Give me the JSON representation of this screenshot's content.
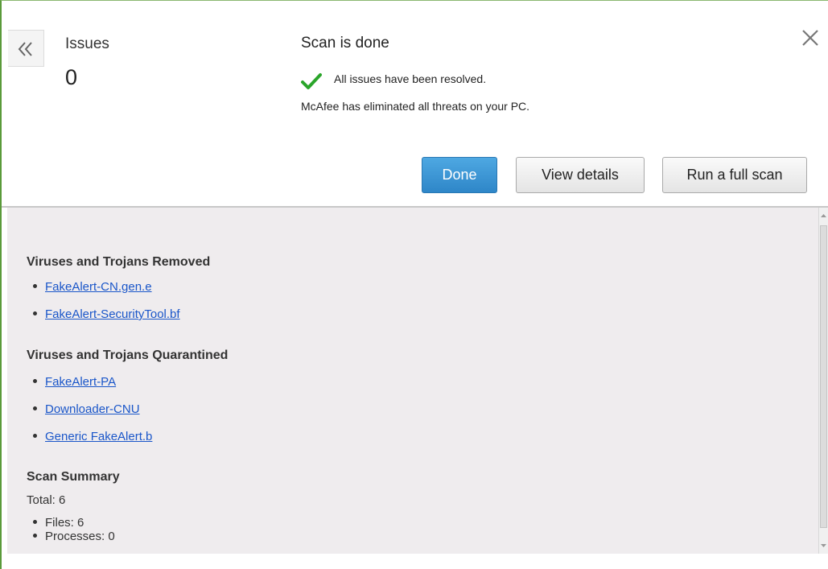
{
  "header": {
    "issues_label": "Issues",
    "issues_count": "0",
    "scan_title": "Scan is done",
    "resolved_text": "All issues have been resolved.",
    "eliminated_text": "McAfee has eliminated all threats on your PC.",
    "buttons": {
      "done": "Done",
      "view_details": "View details",
      "full_scan": "Run a full scan"
    },
    "icons": {
      "back": "double-chevron-left-icon",
      "check": "checkmark-icon",
      "close": "close-icon"
    },
    "colors": {
      "accent_blue": "#2e86c8",
      "check_green": "#2aa52a",
      "frame_green": "#5a9a3a"
    }
  },
  "details": {
    "removed": {
      "heading": "Viruses and Trojans Removed",
      "items": [
        "FakeAlert-CN.gen.e",
        "FakeAlert-SecurityTool.bf"
      ]
    },
    "quarantined": {
      "heading": "Viruses and Trojans Quarantined",
      "items": [
        "FakeAlert-PA",
        "Downloader-CNU",
        "Generic FakeAlert.b"
      ]
    },
    "summary": {
      "heading": "Scan Summary",
      "total": "Total: 6",
      "files": "Files: 6",
      "processes": "Processes: 0"
    },
    "link_color": "#1a56c9"
  }
}
